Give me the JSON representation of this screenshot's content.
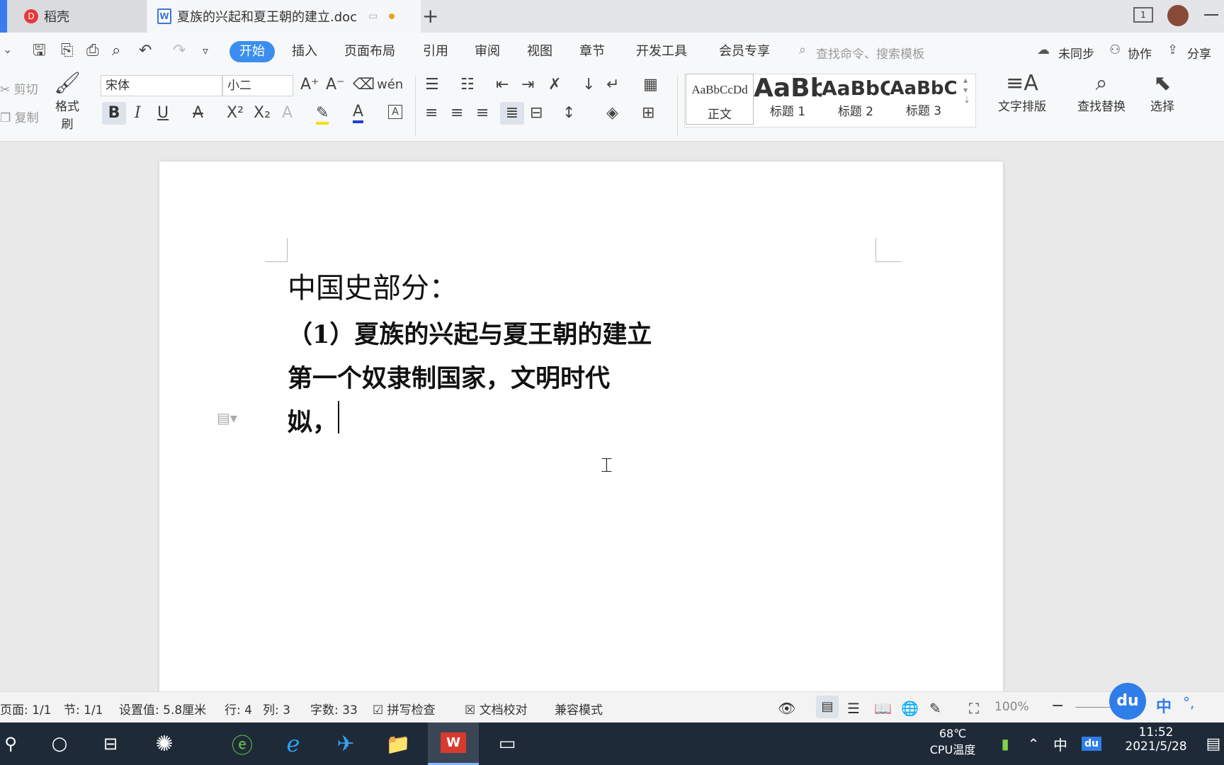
{
  "tabs": [
    {
      "label": "稻壳",
      "icon": "daoke-icon"
    },
    {
      "label": "夏族的兴起和夏王朝的建立.doc",
      "icon": "wps-doc-icon"
    }
  ],
  "menu": {
    "items": [
      "开始",
      "插入",
      "页面布局",
      "引用",
      "审阅",
      "视图",
      "章节",
      "开发工具",
      "会员专享"
    ],
    "search_placeholder": "查找命令、搜索模板",
    "sync": "未同步",
    "collab": "协作",
    "share": "分享"
  },
  "ribbon": {
    "cut": "剪切",
    "copy": "复制",
    "format_painter": "格式刷",
    "font_name": "宋体",
    "font_size": "小二",
    "styles": [
      {
        "preview": "AaBbCcDd",
        "label": "正文"
      },
      {
        "preview": "AaBb",
        "label": "标题 1"
      },
      {
        "preview": "AaBbC",
        "label": "标题 2"
      },
      {
        "preview": "AaBbC",
        "label": "标题 3"
      }
    ],
    "text_layout": "文字排版",
    "find_replace": "查找替换",
    "select": "选择"
  },
  "document": {
    "lines": [
      "中国史部分：",
      "（1）夏族的兴起与夏王朝的建立",
      "第一个奴隶制国家，文明时代",
      "姒，"
    ]
  },
  "status": {
    "page": "页面: 1/1",
    "section": "节: 1/1",
    "setting": "设置值: 5.8厘米",
    "row": "行: 4",
    "col": "列: 3",
    "words": "字数: 33",
    "spell": "拼写检查",
    "proof": "文档校对",
    "compat": "兼容模式",
    "zoom": "100%"
  },
  "taskbar": {
    "temp": "68℃",
    "temp_label": "CPU温度",
    "ime": "中",
    "time": "11:52",
    "date": "2021/5/28"
  },
  "colors": {
    "accent": "#3b8ef0",
    "taskbar": "#1f2a38"
  }
}
